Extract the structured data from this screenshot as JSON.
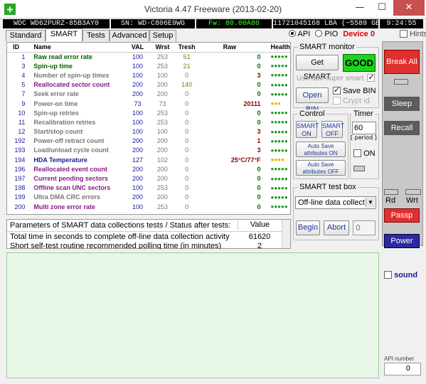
{
  "window": {
    "title": "Victoria 4.47  Freeware (2013-02-20)",
    "minimize": "—",
    "maximize": "☐",
    "close": "✕"
  },
  "infobar": {
    "model": "WDC WD62PURZ-85B3AY0",
    "serial": "SN: WD-C806E9WG",
    "firmware": "Fw: 80.00A80",
    "lba": "11721045168 LBA (~5589 GB)",
    "time": "9:24:55"
  },
  "tabs": [
    "Standard",
    "SMART",
    "Tests",
    "Advanced",
    "Setup"
  ],
  "mode": {
    "api": "API",
    "pio": "PIO",
    "device": "Device 0",
    "hints": "Hints"
  },
  "smart_table": {
    "headers": [
      "ID",
      "Name",
      "VAL",
      "Wrst",
      "Tresh",
      "Raw",
      "Health"
    ],
    "rows": [
      {
        "id": "1",
        "name": "Raw read error rate",
        "val": "100",
        "wrst": "253",
        "tresh": "51",
        "raw": "0",
        "health": "●●●●●",
        "color": "#006400",
        "hcolor": "#1a9a1a"
      },
      {
        "id": "3",
        "name": "Spin-up time",
        "val": "100",
        "wrst": "253",
        "tresh": "21",
        "raw": "0",
        "health": "●●●●●",
        "color": "#006400",
        "hcolor": "#1a9a1a"
      },
      {
        "id": "4",
        "name": "Number of spin-up times",
        "val": "100",
        "wrst": "100",
        "tresh": "0",
        "raw": "3",
        "health": "●●●●●",
        "color": "#777777",
        "hcolor": "#1a9a1a"
      },
      {
        "id": "5",
        "name": "Reallocated sector count",
        "val": "200",
        "wrst": "200",
        "tresh": "140",
        "raw": "0",
        "health": "●●●●●",
        "color": "#8b1a8b",
        "hcolor": "#1a9a1a"
      },
      {
        "id": "7",
        "name": "Seek error rate",
        "val": "200",
        "wrst": "200",
        "tresh": "0",
        "raw": "0",
        "health": "●●●●●",
        "color": "#777777",
        "hcolor": "#1a9a1a"
      },
      {
        "id": "9",
        "name": "Power-on time",
        "val": "73",
        "wrst": "73",
        "tresh": "0",
        "raw": "20111",
        "health": "●●●",
        "color": "#777777",
        "hcolor": "#e0b000"
      },
      {
        "id": "10",
        "name": "Spin-up retries",
        "val": "100",
        "wrst": "253",
        "tresh": "0",
        "raw": "0",
        "health": "●●●●●",
        "color": "#777777",
        "hcolor": "#1a9a1a"
      },
      {
        "id": "11",
        "name": "Recalibration retries",
        "val": "100",
        "wrst": "253",
        "tresh": "0",
        "raw": "0",
        "health": "●●●●●",
        "color": "#777777",
        "hcolor": "#1a9a1a"
      },
      {
        "id": "12",
        "name": "Start/stop count",
        "val": "100",
        "wrst": "100",
        "tresh": "0",
        "raw": "3",
        "health": "●●●●●",
        "color": "#777777",
        "hcolor": "#1a9a1a"
      },
      {
        "id": "192",
        "name": "Power-off retract count",
        "val": "200",
        "wrst": "200",
        "tresh": "0",
        "raw": "1",
        "health": "●●●●●",
        "color": "#777777",
        "hcolor": "#1a9a1a"
      },
      {
        "id": "193",
        "name": "Load/unload cycle count",
        "val": "200",
        "wrst": "200",
        "tresh": "0",
        "raw": "3",
        "health": "●●●●●",
        "color": "#777777",
        "hcolor": "#1a9a1a"
      },
      {
        "id": "194",
        "name": "HDA Temperature",
        "val": "127",
        "wrst": "102",
        "tresh": "0",
        "raw": "25°C/77°F",
        "health": "●●●●",
        "color": "#1a1a9a",
        "hcolor": "#e0b000"
      },
      {
        "id": "196",
        "name": "Reallocated event count",
        "val": "200",
        "wrst": "200",
        "tresh": "0",
        "raw": "0",
        "health": "●●●●●",
        "color": "#8b1a8b",
        "hcolor": "#1a9a1a"
      },
      {
        "id": "197",
        "name": "Current pending sectors",
        "val": "200",
        "wrst": "200",
        "tresh": "0",
        "raw": "0",
        "health": "●●●●●",
        "color": "#8b1a8b",
        "hcolor": "#1a9a1a"
      },
      {
        "id": "198",
        "name": "Offline scan UNC sectors",
        "val": "100",
        "wrst": "253",
        "tresh": "0",
        "raw": "0",
        "health": "●●●●●",
        "color": "#8b1a8b",
        "hcolor": "#1a9a1a"
      },
      {
        "id": "199",
        "name": "Ultra DMA CRC errors",
        "val": "200",
        "wrst": "200",
        "tresh": "0",
        "raw": "0",
        "health": "●●●●●",
        "color": "#777777",
        "hcolor": "#1a9a1a"
      },
      {
        "id": "200",
        "name": "Multi zone error rate",
        "val": "100",
        "wrst": "253",
        "tresh": "0",
        "raw": "0",
        "health": "●●●●●",
        "color": "#8b1a8b",
        "hcolor": "#1a9a1a"
      }
    ]
  },
  "smart_monitor": {
    "title": "SMART monitor",
    "get_smart": "Get SMART",
    "status": "GOOD",
    "ibm": "Use IBM super smart:",
    "open_bin": "Open BIN",
    "save_bin": "Save BIN",
    "crypt": "Crypt id"
  },
  "control": {
    "title": "Control",
    "smart_on": "SMART ON",
    "smart_off": "SMART OFF",
    "autosave_on": "Auto Save attributes ON",
    "autosave_off": "Auto Save attributes OFF"
  },
  "timer": {
    "title": "Timer",
    "value": "60",
    "period": "[ period ]",
    "on": "ON"
  },
  "smart_test": {
    "title": "SMART test box",
    "selected": "Off-line data collect",
    "begin": "Begin",
    "abort": "Abort",
    "value": "0"
  },
  "params": {
    "header": "Parameters of SMART data collections tests / Status after tests:",
    "value_header": "Value",
    "rows": [
      {
        "label": "Total time in seconds to complete off-line data collection activity",
        "value": "61620"
      },
      {
        "label": "Short self-test routine recommended polling time (in minutes)",
        "value": "2"
      }
    ]
  },
  "right": {
    "break_all": "Break All",
    "sleep": "Sleep",
    "recall": "Recall",
    "rd": "Rd",
    "wrt": "Wrt",
    "passp": "Passp",
    "power": "Power",
    "sound": "sound",
    "api_number": "API number",
    "api_value": "0"
  }
}
